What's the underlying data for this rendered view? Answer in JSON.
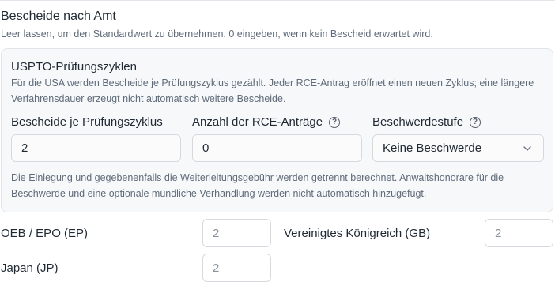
{
  "section": {
    "title": "Bescheide nach Amt",
    "hint": "Leer lassen, um den Standardwert zu übernehmen. 0 eingeben, wenn kein Bescheid erwartet wird."
  },
  "uspto": {
    "title": "USPTO-Prüfungszyklen",
    "description": "Für die USA werden Bescheide je Prüfungszyklus gezählt. Jeder RCE-Antrag eröffnet einen neuen Zyklus; eine längere Verfahrensdauer erzeugt nicht automatisch weitere Bescheide.",
    "fields": {
      "per_cycle": {
        "label": "Bescheide je Prüfungszyklus",
        "value": "2"
      },
      "rce_count": {
        "label": "Anzahl der RCE-Anträge",
        "value": "0",
        "help_icon": "question-circle-icon"
      },
      "appeal": {
        "label": "Beschwerdestufe",
        "value": "Keine Beschwerde",
        "help_icon": "question-circle-icon",
        "dropdown_icon": "chevron-down-icon"
      }
    },
    "footer": "Die Einlegung und gegebenenfalls die Weiterleitungsgebühr werden getrennt berechnet. Anwaltshonorare für die Beschwerde und eine optionale mündliche Verhandlung werden nicht automatisch hinzugefügt."
  },
  "offices": [
    {
      "label": "OEB / EPO (EP)",
      "placeholder": "2"
    },
    {
      "label": "Vereinigtes Königreich (GB)",
      "placeholder": "2"
    },
    {
      "label": "Japan (JP)",
      "placeholder": "2"
    }
  ],
  "colors": {
    "text": "#1f2933",
    "muted": "#5f6b7a",
    "panel_bg": "#f7f8fa",
    "border": "#d6dade",
    "placeholder": "#8b939c"
  }
}
